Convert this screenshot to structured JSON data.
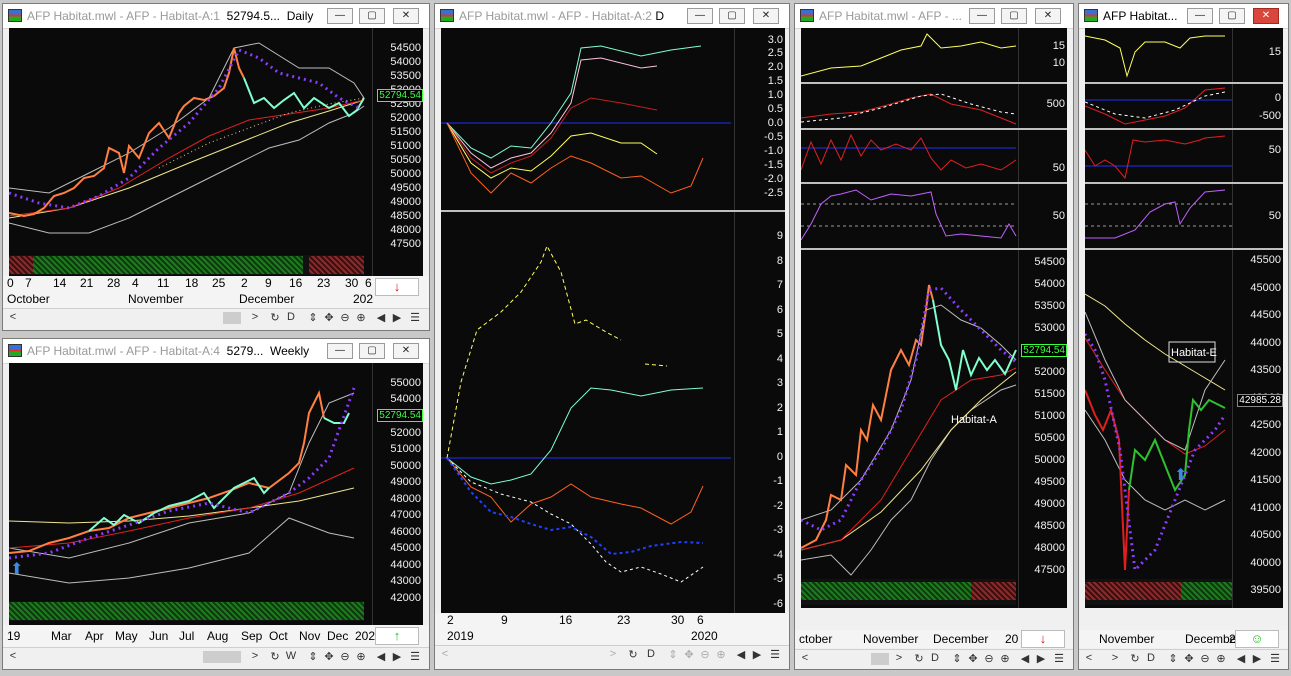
{
  "windows": {
    "w1": {
      "title": "AFP Habitat.mwl - AFP - Habitat-A:1",
      "title_price": "52794.5...",
      "title_period": "Daily",
      "last_price": "52794.54",
      "ticks": [
        "54500",
        "54000",
        "53500",
        "53000",
        "52500",
        "52000",
        "51500",
        "51000",
        "50500",
        "50000",
        "49500",
        "49000",
        "48500",
        "48000",
        "47500"
      ],
      "day_labels": [
        "0",
        "7",
        "14",
        "21",
        "28",
        "4",
        "11",
        "18",
        "25",
        "2",
        "9",
        "16",
        "23",
        "30",
        "6"
      ],
      "month_labels": [
        "October",
        "November",
        "December",
        "202"
      ],
      "signal": "↓"
    },
    "w2": {
      "title": "AFP Habitat.mwl - AFP - Habitat-A:4",
      "title_price": "5279...",
      "title_period": "Weekly",
      "last_price": "52794.54",
      "ticks": [
        "55000",
        "54000",
        "53000",
        "52000",
        "51000",
        "50000",
        "49000",
        "48000",
        "47000",
        "46000",
        "45000",
        "44000",
        "43000",
        "42000"
      ],
      "month_labels": [
        "19",
        "Mar",
        "Apr",
        "May",
        "Jun",
        "Jul",
        "Aug",
        "Sep",
        "Oct",
        "Nov",
        "Dec",
        "202"
      ],
      "signal": "↑"
    },
    "w3": {
      "title": "AFP Habitat.mwl - AFP - Habitat-A:2",
      "title_suffix": "D",
      "ticks_top": [
        "3.0",
        "2.5",
        "2.0",
        "1.5",
        "1.0",
        "0.5",
        "0.0",
        "-0.5",
        "-1.0",
        "-1.5",
        "-2.0",
        "-2.5"
      ],
      "ticks_bottom": [
        "9",
        "8",
        "7",
        "6",
        "5",
        "4",
        "3",
        "2",
        "1",
        "0",
        "-1",
        "-2",
        "-3",
        "-4",
        "-5",
        "-6"
      ],
      "day_labels": [
        "2",
        "9",
        "16",
        "23",
        "30",
        "6"
      ],
      "year_labels": [
        "2019",
        "2020"
      ]
    },
    "w4": {
      "title": "AFP Habitat.mwl - AFP - ...",
      "ticks_p1": [
        "15",
        "10"
      ],
      "ticks_p2": [
        "500"
      ],
      "ticks_p3": [
        "50"
      ],
      "ticks_p4": [
        "50"
      ],
      "ticks_main": [
        "54500",
        "54000",
        "53500",
        "53000",
        "52500",
        "52000",
        "51500",
        "51000",
        "50500",
        "50000",
        "49500",
        "49000",
        "48500",
        "48000",
        "47500"
      ],
      "last_price": "52794.54",
      "annotation": "Habitat-A",
      "month_labels": [
        "ctober",
        "November",
        "December",
        "20"
      ],
      "signal": "↓"
    },
    "w5": {
      "title": "AFP Habitat...",
      "ticks_p1": [
        "15"
      ],
      "ticks_p2": [
        "0",
        "-500"
      ],
      "ticks_p3": [
        "50"
      ],
      "ticks_p4": [
        "50"
      ],
      "ticks_main": [
        "45500",
        "45000",
        "44500",
        "44000",
        "43500",
        "43000",
        "42500",
        "42000",
        "41500",
        "41000",
        "40500",
        "40000",
        "39500"
      ],
      "last_price": "42985.28",
      "annotation": "Habitat-E",
      "month_labels": [
        "November",
        "December",
        "2"
      ],
      "signal": "☺"
    }
  },
  "toolbar_glyphs": {
    "left": "<",
    "right": ">",
    "sync": "↻",
    "d": "D",
    "w": "W",
    "move": "⇕",
    "cross": "✥",
    "zoomout": "⊖",
    "zoomin": "⊕",
    "prev": "◀",
    "next": "▶",
    "menu": "☰"
  },
  "titlebar_glyphs": {
    "min": "—",
    "max": "▢",
    "close": "✕"
  }
}
